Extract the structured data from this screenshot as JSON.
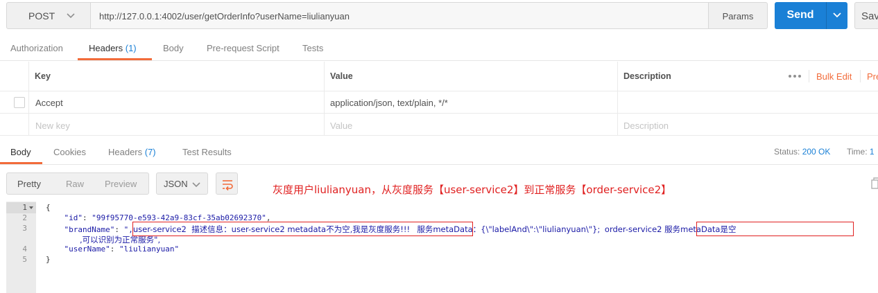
{
  "request": {
    "method": "POST",
    "url": "http://127.0.0.1:4002/user/getOrderInfo?userName=liulianyuan",
    "params_label": "Params",
    "send_label": "Send",
    "save_label": "Sav"
  },
  "request_tabs": [
    {
      "label": "Authorization",
      "count": ""
    },
    {
      "label": "Headers ",
      "count": "(1)"
    },
    {
      "label": "Body",
      "count": ""
    },
    {
      "label": "Pre-request Script",
      "count": ""
    },
    {
      "label": "Tests",
      "count": ""
    }
  ],
  "headers_table": {
    "columns": {
      "key": "Key",
      "value": "Value",
      "description": "Description"
    },
    "bulk_edit": "Bulk Edit",
    "presets": "Pre",
    "rows": [
      {
        "key": "Accept",
        "value": "application/json, text/plain, */*",
        "description": ""
      }
    ],
    "placeholders": {
      "key": "New key",
      "value": "Value",
      "description": "Description"
    }
  },
  "response_tabs": [
    {
      "label": "Body",
      "count": ""
    },
    {
      "label": "Cookies",
      "count": ""
    },
    {
      "label": "Headers ",
      "count": "(7)"
    },
    {
      "label": "Test Results",
      "count": ""
    }
  ],
  "status": {
    "label": "Status:",
    "value": "200 OK"
  },
  "time": {
    "label": "Time:",
    "value": "1"
  },
  "view_modes": [
    "Pretty",
    "Raw",
    "Preview"
  ],
  "format": "JSON",
  "annotation": "灰度用户liulianyuan，从灰度服务【user-service2】到正常服务【order-service2】",
  "editor": {
    "line_numbers": [
      "1",
      "2",
      "3",
      "4",
      "5"
    ],
    "line1": "{",
    "id_key": "\"id\"",
    "id_value": "\"99f95770-e593-42a9-83cf-35ab02692370\"",
    "brand_key": "\"brandName\"",
    "brand_open": "\",",
    "brand_seg1": "user-service2  描述信息：user-service2 metadata不为空,我是灰度服务!!!",
    "brand_seg2": " 服务metaData：{\\\"labelAnd\\\":\\\"liulianyuan\\\"};",
    "brand_seg3": "order-service2 服务metaData是空",
    "brand_seg4": ",可以识别为正常服务\",",
    "user_key": "\"userName\"",
    "user_value": "\"liulianyuan\"",
    "line5": "}"
  },
  "colors": {
    "accent": "#f26b3a",
    "send": "#1a80d6",
    "annotation": "#e02020"
  }
}
